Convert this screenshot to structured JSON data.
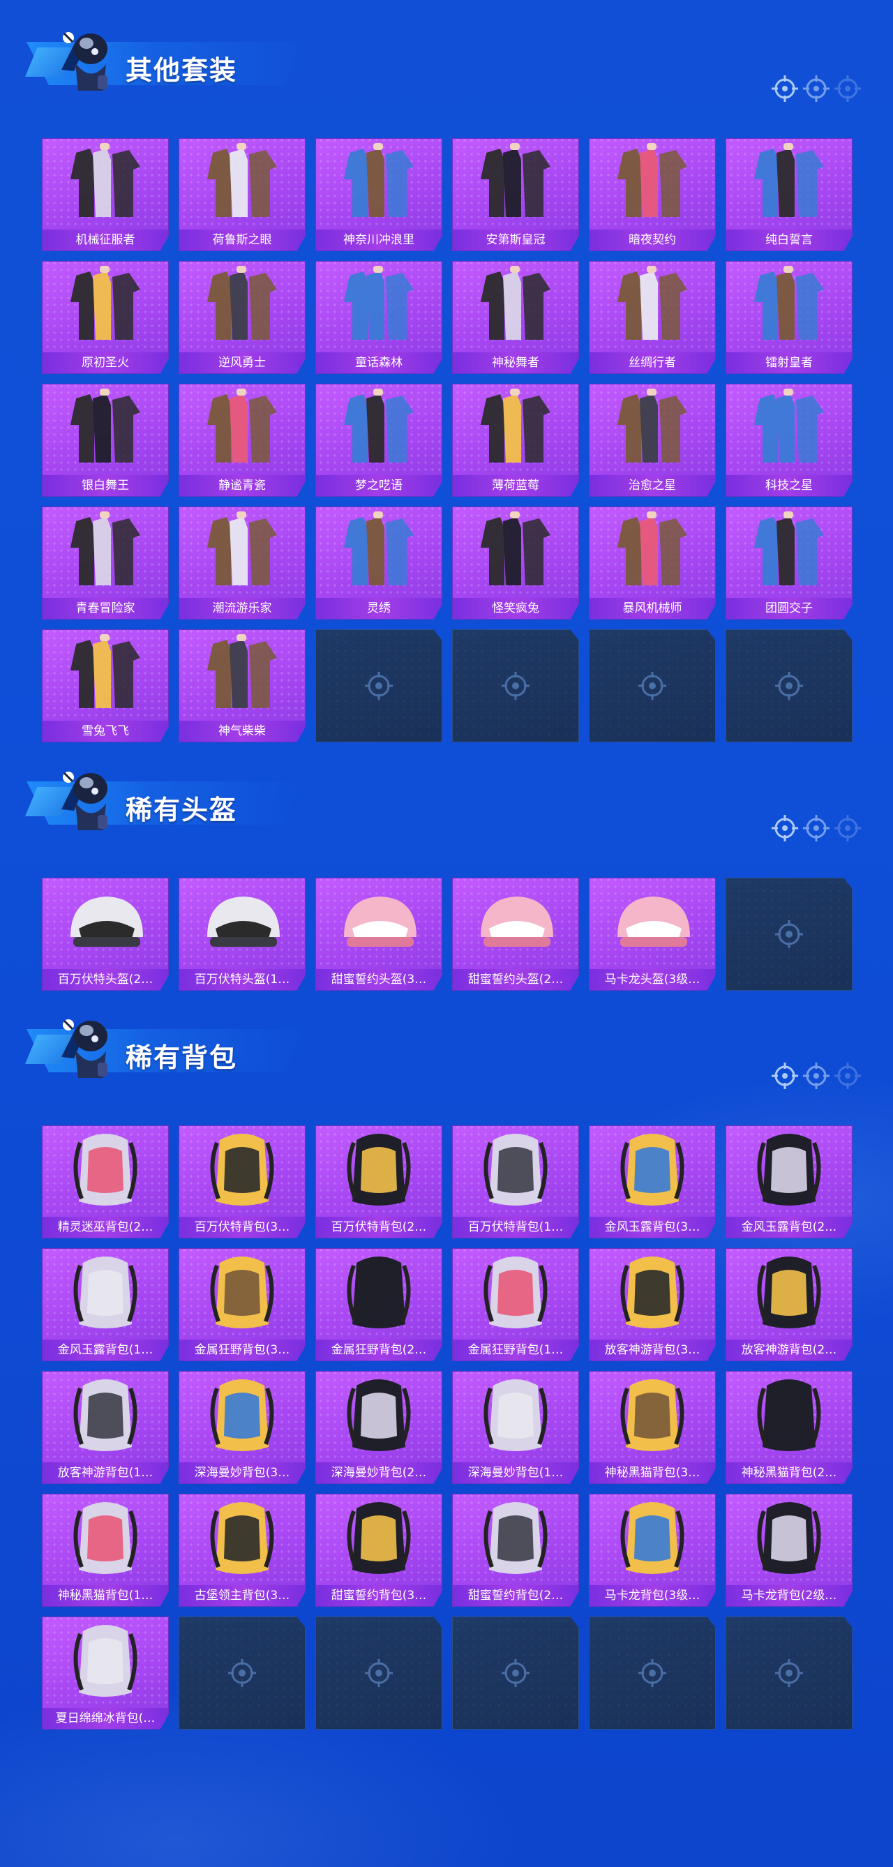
{
  "sections": [
    {
      "title": "其他套装",
      "items": [
        "机械征服者",
        "荷鲁斯之眼",
        "神奈川冲浪里",
        "安第斯皇冠",
        "暗夜契约",
        "纯白誓言",
        "原初圣火",
        "逆风勇士",
        "童话森林",
        "神秘舞者",
        "丝绸行者",
        "镭射皇者",
        "银白舞王",
        "静谧青瓷",
        "梦之呓语",
        "薄荷蓝莓",
        "治愈之星",
        "科技之星",
        "青春冒险家",
        "潮流游乐家",
        "灵绣",
        "怪笑疯兔",
        "暴风机械师",
        "团圆交子",
        "雪兔飞飞",
        "神气柴柴"
      ],
      "empty": 4
    },
    {
      "title": "稀有头盔",
      "items": [
        "百万伏特头盔(2…",
        "百万伏特头盔(1…",
        "甜蜜誓约头盔(3…",
        "甜蜜誓约头盔(2…",
        "马卡龙头盔(3级…"
      ],
      "empty": 1
    },
    {
      "title": "稀有背包",
      "items": [
        "精灵迷巫背包(2…",
        "百万伏特背包(3…",
        "百万伏特背包(2…",
        "百万伏特背包(1…",
        "金风玉露背包(3…",
        "金风玉露背包(2…",
        "金风玉露背包(1…",
        "金属狂野背包(3…",
        "金属狂野背包(2…",
        "金属狂野背包(1…",
        "放客神游背包(3…",
        "放客神游背包(2…",
        "放客神游背包(1…",
        "深海曼妙背包(3…",
        "深海曼妙背包(2…",
        "深海曼妙背包(1…",
        "神秘黑猫背包(3…",
        "神秘黑猫背包(2…",
        "神秘黑猫背包(1…",
        "古堡领主背包(3…",
        "甜蜜誓约背包(3…",
        "甜蜜誓约背包(2…",
        "马卡龙背包(3级…",
        "马卡龙背包(2级…",
        "夏日绵绵冰背包(…"
      ],
      "empty": 5
    }
  ],
  "colors": {
    "background": "#0f4fd8",
    "tile": "#a646f2",
    "label_bar": "#7a2fe0",
    "empty_tile": "#1e3a66"
  },
  "icons": {
    "mascot": "mascot-icon",
    "target": "crosshair-icon"
  }
}
